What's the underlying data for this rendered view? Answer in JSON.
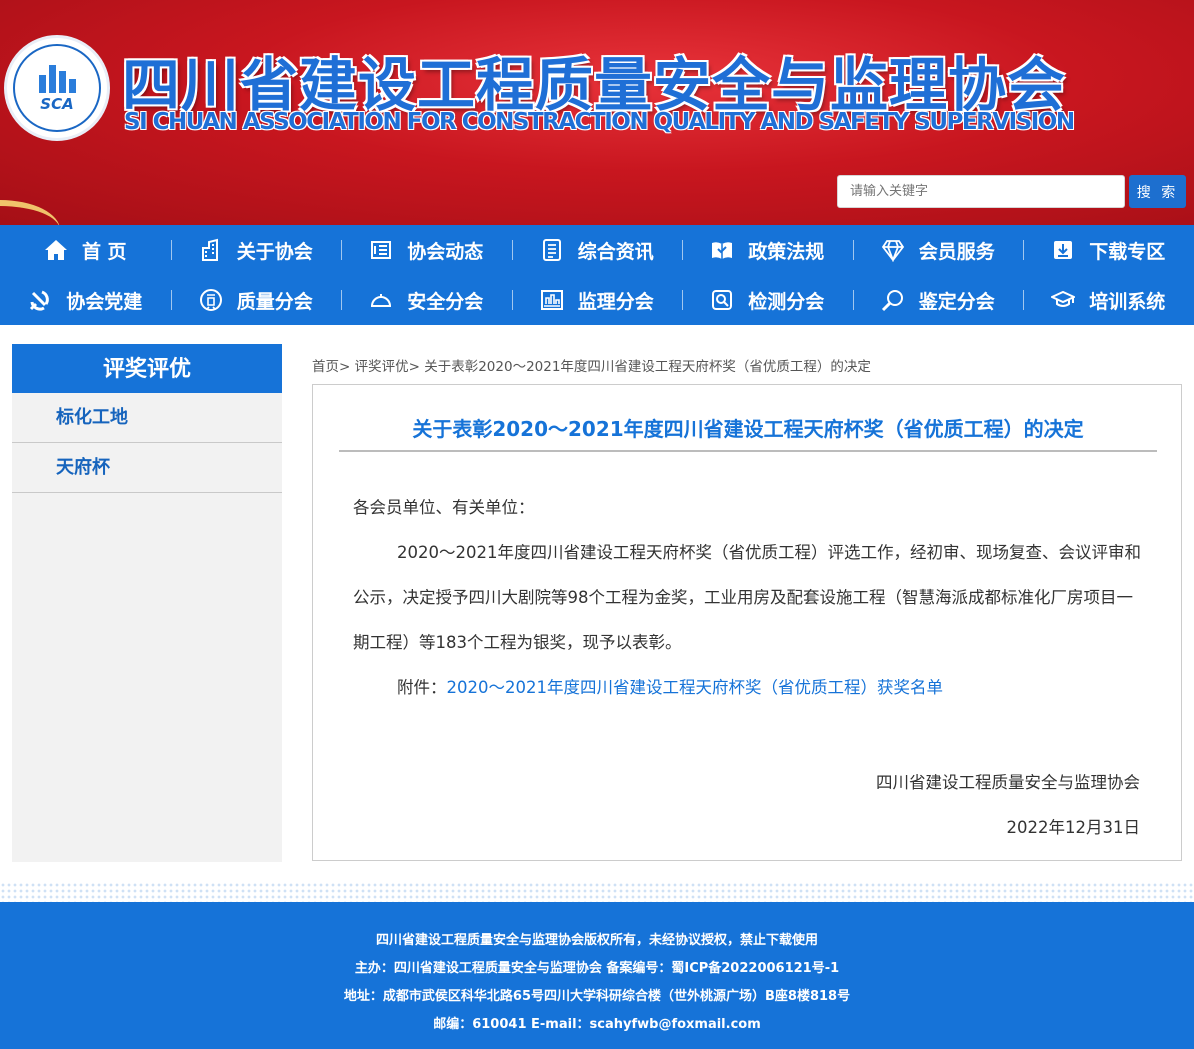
{
  "header": {
    "logo_text": "SCA",
    "title_cn": "四川省建设工程质量安全与监理协会",
    "title_en": "SI CHUAN ASSOCIATION FOR CONSTRACTION QUALITY AND SAFETY SUPERVISION",
    "search_placeholder": "请输入关键字",
    "search_button": "搜 索"
  },
  "nav": {
    "row1": [
      {
        "label": "首 页",
        "icon": "home-icon"
      },
      {
        "label": "关于协会",
        "icon": "building-icon"
      },
      {
        "label": "协会动态",
        "icon": "news-icon"
      },
      {
        "label": "综合资讯",
        "icon": "document-icon"
      },
      {
        "label": "政策法规",
        "icon": "book-icon"
      },
      {
        "label": "会员服务",
        "icon": "diamond-icon"
      },
      {
        "label": "下载专区",
        "icon": "download-icon"
      }
    ],
    "row2": [
      {
        "label": "协会党建",
        "icon": "party-icon"
      },
      {
        "label": "质量分会",
        "icon": "quality-icon"
      },
      {
        "label": "安全分会",
        "icon": "helmet-icon"
      },
      {
        "label": "监理分会",
        "icon": "supervision-icon"
      },
      {
        "label": "检测分会",
        "icon": "inspection-icon"
      },
      {
        "label": "鉴定分会",
        "icon": "magnifier-icon"
      },
      {
        "label": "培训系统",
        "icon": "graduation-icon"
      }
    ]
  },
  "sidebar": {
    "title": "评奖评优",
    "items": [
      "标化工地",
      "天府杯"
    ]
  },
  "breadcrumb": [
    "首页",
    "评奖评优",
    "关于表彰2020～2021年度四川省建设工程天府杯奖（省优质工程）的决定"
  ],
  "article": {
    "title": "关于表彰2020～2021年度四川省建设工程天府杯奖（省优质工程）的决定",
    "greeting": "各会员单位、有关单位：",
    "paragraph": "2020～2021年度四川省建设工程天府杯奖（省优质工程）评选工作，经初审、现场复查、会议评审和公示，决定授予四川大剧院等98个工程为金奖，工业用房及配套设施工程（智慧海派成都标准化厂房项目一期工程）等183个工程为银奖，现予以表彰。",
    "attachment_label": "附件：",
    "attachment_link": "2020～2021年度四川省建设工程天府杯奖（省优质工程）获奖名单",
    "signature": "四川省建设工程质量安全与监理协会",
    "date": "2022年12月31日"
  },
  "footer": {
    "line1": "四川省建设工程质量安全与监理协会版权所有，未经协议授权，禁止下载使用",
    "line2": "主办：四川省建设工程质量安全与监理协会 备案编号：蜀ICP备2022006121号-1",
    "line3": "地址：成都市武侯区科华北路65号四川大学科研综合楼（世外桃源广场）B座8楼818号",
    "line4": "邮编：610041 E-mail：scahyfwb@foxmail.com"
  }
}
